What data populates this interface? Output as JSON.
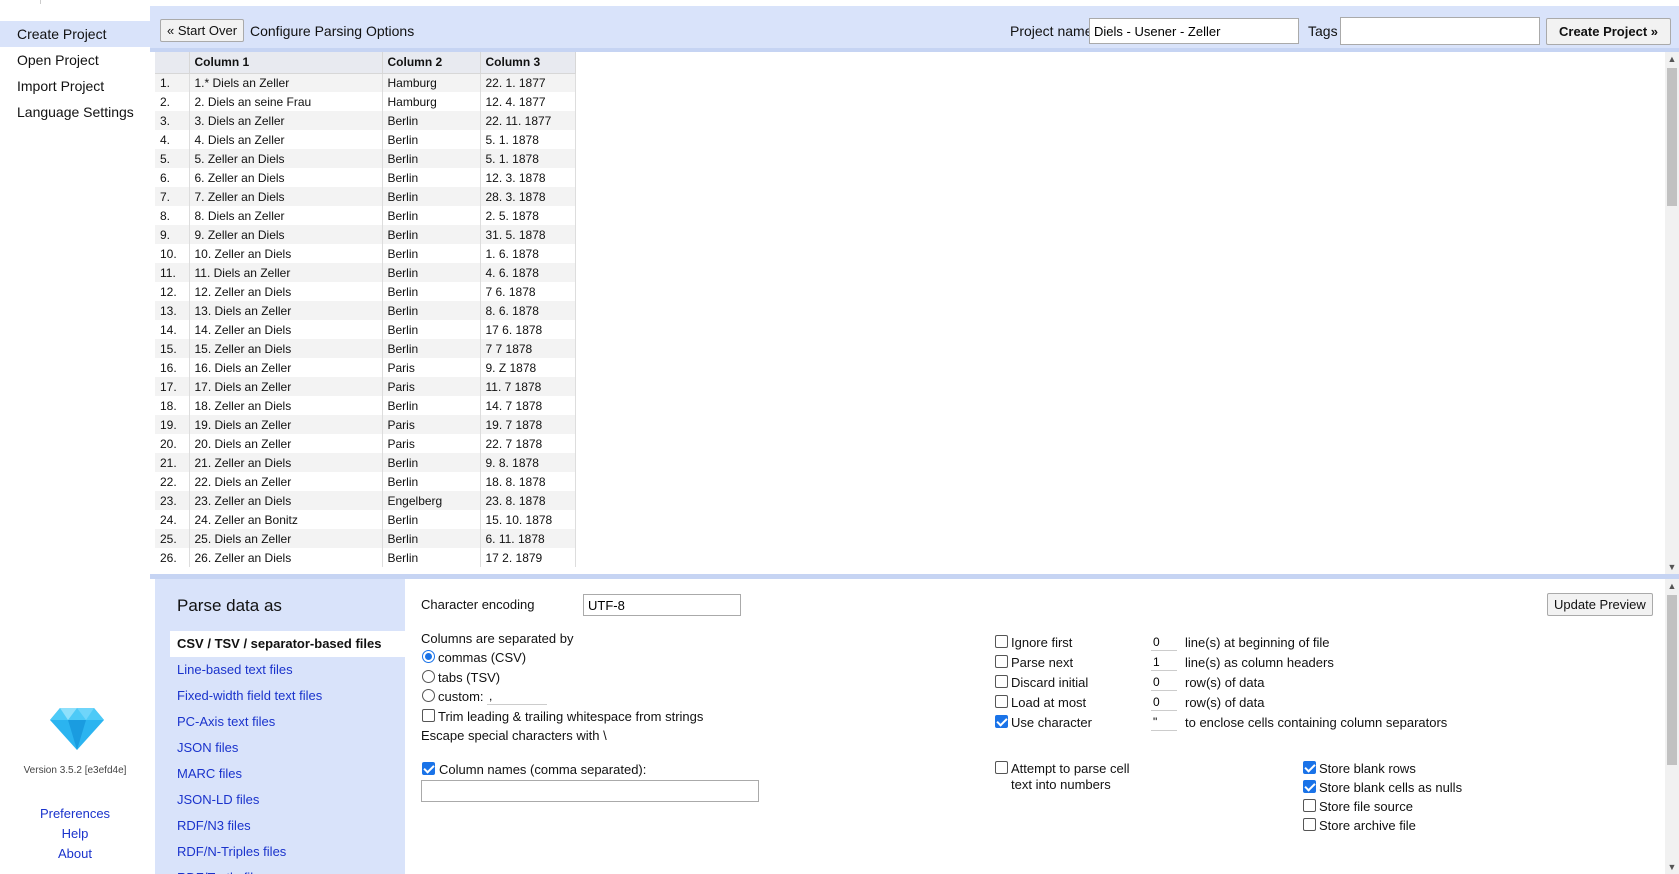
{
  "nav": {
    "items": [
      "Create Project",
      "Open Project",
      "Import Project",
      "Language Settings"
    ],
    "version": "Version 3.5.2 [e3efd4e]",
    "footer": [
      "Preferences",
      "Help",
      "About"
    ]
  },
  "header": {
    "start_over": "« Start Over",
    "title": "Configure Parsing Options",
    "project_name_label": "Project name",
    "project_name_value": "Diels - Usener - Zeller",
    "tags_label": "Tags",
    "create_label": "Create Project »"
  },
  "preview": {
    "columns": [
      "Column 1",
      "Column 2",
      "Column 3"
    ],
    "rows": [
      [
        "1.",
        "1.* Diels an Zeller",
        "Hamburg",
        "22. 1. 1877"
      ],
      [
        "2.",
        "2. Diels an seine Frau",
        "Hamburg",
        "12. 4. 1877"
      ],
      [
        "3.",
        "3. Diels an Zeller",
        "Berlin",
        "22. 11. 1877"
      ],
      [
        "4.",
        "4. Diels an Zeller",
        "Berlin",
        "5. 1. 1878"
      ],
      [
        "5.",
        "5. Zeller an Diels",
        "Berlin",
        "5. 1. 1878"
      ],
      [
        "6.",
        "6. Zeller an Diels",
        "Berlin",
        "12. 3. 1878"
      ],
      [
        "7.",
        "7. Zeller an Diels",
        "Berlin",
        "28. 3. 1878"
      ],
      [
        "8.",
        "8. Diels an Zeller",
        "Berlin",
        "2. 5. 1878"
      ],
      [
        "9.",
        "9. Zeller an Diels",
        "Berlin",
        "31. 5. 1878"
      ],
      [
        "10.",
        "10. Zeller an Diels",
        "Berlin",
        "1. 6. 1878"
      ],
      [
        "11.",
        " 11. Diels an Zeller",
        "Berlin",
        "4. 6. 1878"
      ],
      [
        "12.",
        " 12. Zeller an Diels",
        "Berlin",
        "7 6. 1878"
      ],
      [
        "13.",
        " 13. Diels an Zeller",
        "Berlin",
        "8. 6. 1878"
      ],
      [
        "14.",
        " 14. Zeller an Diels",
        "Berlin",
        "17 6. 1878"
      ],
      [
        "15.",
        " 15. Zeller an Diels",
        "Berlin",
        "7 7 1878"
      ],
      [
        "16.",
        " 16. Diels an Zeller",
        "Paris",
        "9. Z 1878"
      ],
      [
        "17.",
        " 17. Diels an Zeller",
        "Paris",
        "11. 7 1878"
      ],
      [
        "18.",
        " 18. Zeller an Diels",
        "Berlin",
        "14. 7 1878"
      ],
      [
        "19.",
        " 19. Diels an Zeller",
        "Paris",
        "19. 7 1878"
      ],
      [
        "20.",
        " 20. Diels an Zeller",
        "Paris",
        "22. 7 1878"
      ],
      [
        "21.",
        " 21. Zeller an Diels",
        "Berlin",
        "9. 8. 1878"
      ],
      [
        "22.",
        " 22. Diels an Zeller",
        "Berlin",
        "18. 8. 1878"
      ],
      [
        "23.",
        " 23. Zeller an Diels",
        "Engelberg",
        "23. 8. 1878"
      ],
      [
        "24.",
        " 24. Zeller an Bonitz",
        "Berlin",
        "15. 10. 1878"
      ],
      [
        "25.",
        " 25. Diels an Zeller",
        "Berlin",
        "6. 11. 1878"
      ],
      [
        "26.",
        " 26. Zeller an Diels",
        "Berlin",
        "17 2. 1879"
      ]
    ]
  },
  "format": {
    "heading": "Parse data as",
    "items": [
      "CSV / TSV / separator-based files",
      "Line-based text files",
      "Fixed-width field text files",
      "PC-Axis text files",
      "JSON files",
      "MARC files",
      "JSON-LD files",
      "RDF/N3 files",
      "RDF/N-Triples files",
      "RDF/Turtle files"
    ]
  },
  "options": {
    "encoding_label": "Character encoding",
    "encoding_value": "UTF-8",
    "update_preview": "Update Preview",
    "separated_by": "Columns are separated by",
    "sep_commas": "commas (CSV)",
    "sep_tabs": "tabs (TSV)",
    "sep_custom": "custom:",
    "custom_value": ",",
    "trim": "Trim leading & trailing whitespace from strings",
    "escape": "Escape special characters with \\",
    "column_names": "Column names (comma separated):",
    "ignore_first": "Ignore first",
    "ignore_first_value": "0",
    "ignore_first_suffix": "line(s) at beginning of file",
    "parse_next": "Parse next",
    "parse_next_value": "1",
    "parse_next_suffix": "line(s) as column headers",
    "discard_initial": "Discard initial",
    "discard_initial_value": "0",
    "discard_initial_suffix": "row(s) of data",
    "load_at_most": "Load at most",
    "load_at_most_value": "0",
    "load_at_most_suffix": "row(s) of data",
    "use_character": "Use character",
    "use_character_value": "\"",
    "use_character_suffix": "to enclose cells containing column separators",
    "attempt_parse_1": "Attempt to parse cell",
    "attempt_parse_2": "text into numbers",
    "store_blank_rows": "Store blank rows",
    "store_blank_nulls": "Store blank cells as nulls",
    "store_file_source": "Store file source",
    "store_archive_file": "Store archive file"
  },
  "colors": {
    "accent": "#d9e3fa",
    "link": "#1a33cc",
    "check": "#1a73e8"
  }
}
